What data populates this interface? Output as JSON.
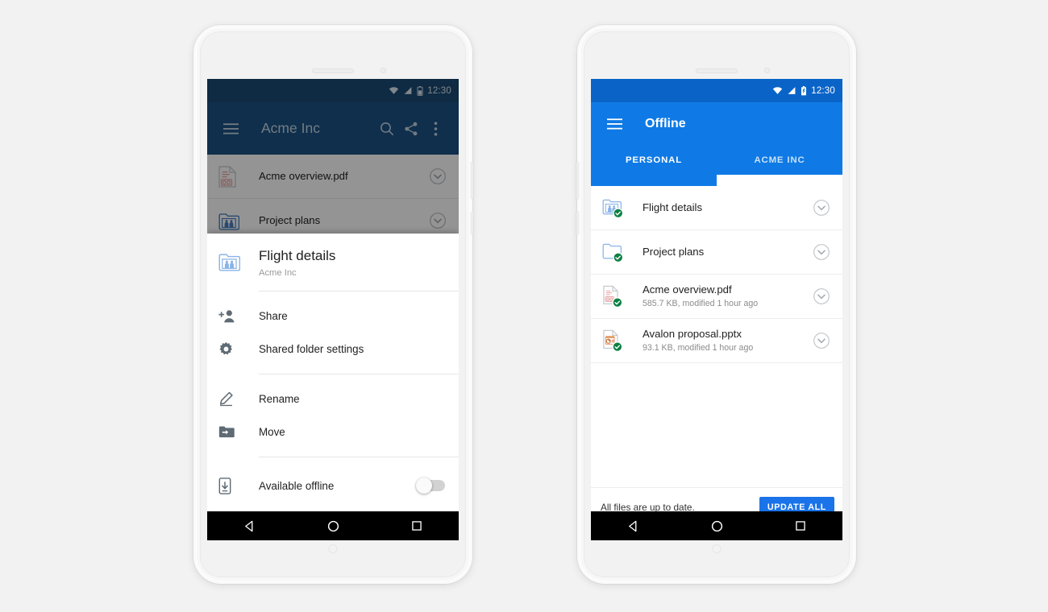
{
  "colors": {
    "background": "#f2f2f2",
    "left_statusbar": "#1a4a74",
    "left_toolbar": "#1b5183",
    "right_statusbar": "#0a64c8",
    "right_toolbar": "#0f7ae5",
    "accent_blue": "#1a73e8",
    "sync_green": "#0b8043",
    "folder_blue": "#8ab4e8",
    "nav_black": "#000000",
    "text_primary": "#212121",
    "text_secondary": "#8b8b8b"
  },
  "left_phone": {
    "statusbar": {
      "time": "12:30",
      "icons": [
        "wifi-icon",
        "signal-icon",
        "battery-icon"
      ]
    },
    "toolbar": {
      "menu_icon": "hamburger-menu-icon",
      "title": "Acme Inc",
      "actions": [
        "search-icon",
        "share-icon",
        "overflow-menu-icon"
      ]
    },
    "background_list": [
      {
        "icon": "pdf-file-icon",
        "title": "Acme overview.pdf",
        "chevron": "chevron-down-circle-icon"
      },
      {
        "icon": "shared-folder-icon",
        "title": "Project plans",
        "chevron": "chevron-down-circle-icon"
      }
    ],
    "sheet": {
      "icon": "shared-folder-icon",
      "title": "Flight details",
      "subtitle": "Acme Inc",
      "menu_groups": [
        [
          {
            "icon": "person-add-icon",
            "label": "Share"
          },
          {
            "icon": "gear-icon",
            "label": "Shared folder settings"
          }
        ],
        [
          {
            "icon": "pencil-icon",
            "label": "Rename"
          },
          {
            "icon": "folder-move-icon",
            "label": "Move"
          }
        ],
        [
          {
            "icon": "phone-download-icon",
            "label": "Available offline",
            "toggle": true,
            "toggle_on": false
          }
        ]
      ]
    }
  },
  "right_phone": {
    "statusbar": {
      "time": "12:30",
      "icons": [
        "wifi-icon",
        "signal-icon",
        "battery-icon"
      ]
    },
    "toolbar": {
      "menu_icon": "hamburger-menu-icon",
      "title": "Offline"
    },
    "tabs": [
      {
        "label": "PERSONAL",
        "active": true
      },
      {
        "label": "ACME INC",
        "active": false
      }
    ],
    "files": [
      {
        "icon": "shared-folder-icon",
        "badge": "sync-check-badge",
        "title": "Flight details",
        "subtitle": "",
        "chevron": "chevron-down-circle-icon"
      },
      {
        "icon": "folder-icon",
        "badge": "sync-check-badge",
        "title": "Project plans",
        "subtitle": "",
        "chevron": "chevron-down-circle-icon"
      },
      {
        "icon": "pdf-file-icon",
        "badge": "sync-check-badge",
        "title": "Acme overview.pdf",
        "subtitle": "585.7 KB, modified 1 hour ago",
        "chevron": "chevron-down-circle-icon"
      },
      {
        "icon": "pptx-file-icon",
        "badge": "sync-check-badge",
        "title": "Avalon proposal.pptx",
        "subtitle": "93.1 KB, modified 1 hour ago",
        "chevron": "chevron-down-circle-icon"
      }
    ],
    "bottom_bar": {
      "status_text": "All files are up to date.",
      "button_label": "UPDATE ALL"
    }
  },
  "navbar": {
    "back": "back-triangle-icon",
    "home": "home-circle-icon",
    "recents": "recents-square-icon"
  }
}
